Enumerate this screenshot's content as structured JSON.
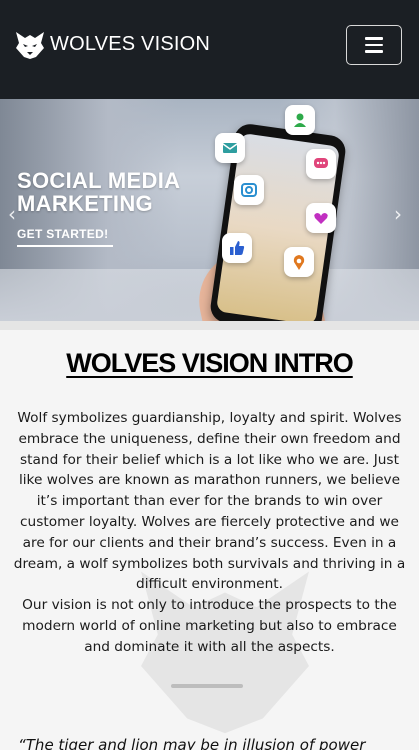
{
  "header": {
    "brand": "WOLVES VISION",
    "logo_icon": "wolf-head-icon",
    "menu_icon": "hamburger-icon",
    "background": "#1b1f24"
  },
  "hero": {
    "title_line1": "SOCIAL MEDIA",
    "title_line2": "MARKETING",
    "cta": "GET STARTED!",
    "prev_icon": "chevron-left-icon",
    "next_icon": "chevron-right-icon",
    "social_icons": [
      "email-icon",
      "user-icon",
      "chat-icon",
      "camera-icon",
      "heart-icon",
      "like-icon",
      "location-icon"
    ]
  },
  "intro": {
    "title": "WOLVES VISION INTRO",
    "paragraph1": "Wolf symbolizes guardianship, loyalty and spirit. Wolves embrace the uniqueness, define their own freedom and stand for their belief which is a lot like who we are. Just like wolves are known as marathon runners, we believe it’s important than ever for the brands to win over customer loyalty. Wolves are fiercely protective and we are for our clients and their brand’s success. Even in a dream, a wolf symbolizes both survivals and thriving in a difficult environment.",
    "paragraph2": "Our vision is not only to introduce the prospects to the modern world of online marketing but also to embrace and dominate it with all the aspects."
  },
  "quote": {
    "text": "“The tiger and lion may be in illusion of power"
  }
}
